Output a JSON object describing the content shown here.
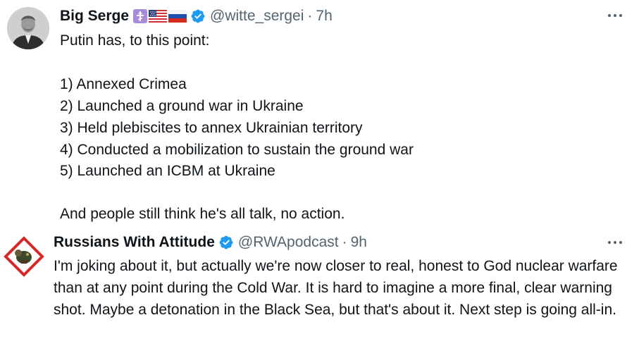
{
  "tweets": [
    {
      "display_name": "Big Serge",
      "emoji_badges": [
        "orthodox-cross",
        "us-flag",
        "russia-flag"
      ],
      "verified": true,
      "handle": "@witte_sergei",
      "separator": "·",
      "time": "7h",
      "lines": [
        "Putin has, to this point:",
        "1) Annexed Crimea",
        "2) Launched a ground war in Ukraine",
        "3) Held plebiscites to annex Ukrainian territory",
        "4) Conducted a mobilization to sustain the ground war",
        "5) Launched an ICBM at Ukraine",
        "And people still think he's all talk, no action."
      ]
    },
    {
      "display_name": "Russians With Attitude",
      "verified": true,
      "handle": "@RWApodcast",
      "separator": "·",
      "time": "9h",
      "text": "I'm joking about it, but actually we're now closer to real, honest to God nuclear warfare than at any point during the Cold War. It is hard to imagine a more final, clear warning shot. Maybe a detonation in the Black Sea, but that's about it. Next step is going all-in."
    }
  ],
  "colors": {
    "text_primary": "#0f1419",
    "text_secondary": "#536471",
    "verified_blue": "#1d9bf0",
    "cross_badge_purple": "#a98bdc",
    "rwa_diamond_red": "#d62828"
  },
  "icons": [
    "avatar-portrait",
    "avatar-hazard-diamond",
    "verified-badge-icon",
    "more-options-icon"
  ]
}
